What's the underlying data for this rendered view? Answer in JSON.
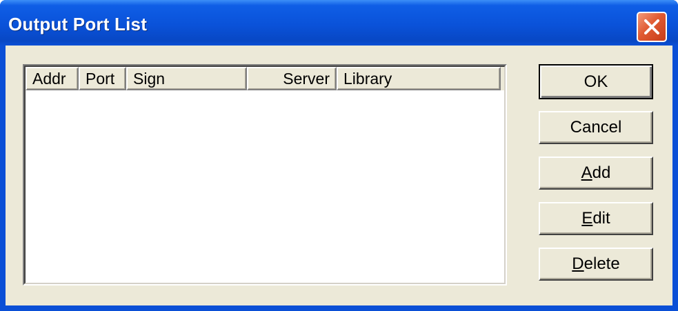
{
  "window": {
    "title": "Output Port List"
  },
  "listview": {
    "columns": [
      "Addr",
      "Port",
      "Sign",
      "Server",
      "Library"
    ],
    "rows": []
  },
  "buttons": {
    "ok": "OK",
    "cancel": "Cancel",
    "add_mnemonic": "A",
    "add_rest": "dd",
    "edit_mnemonic": "E",
    "edit_rest": "dit",
    "delete_mnemonic": "D",
    "delete_rest": "elete"
  },
  "icons": {
    "close": "close-icon"
  },
  "colors": {
    "titlebar": "#0a52d9",
    "client": "#ece9d8",
    "close_button": "#e05a32"
  }
}
